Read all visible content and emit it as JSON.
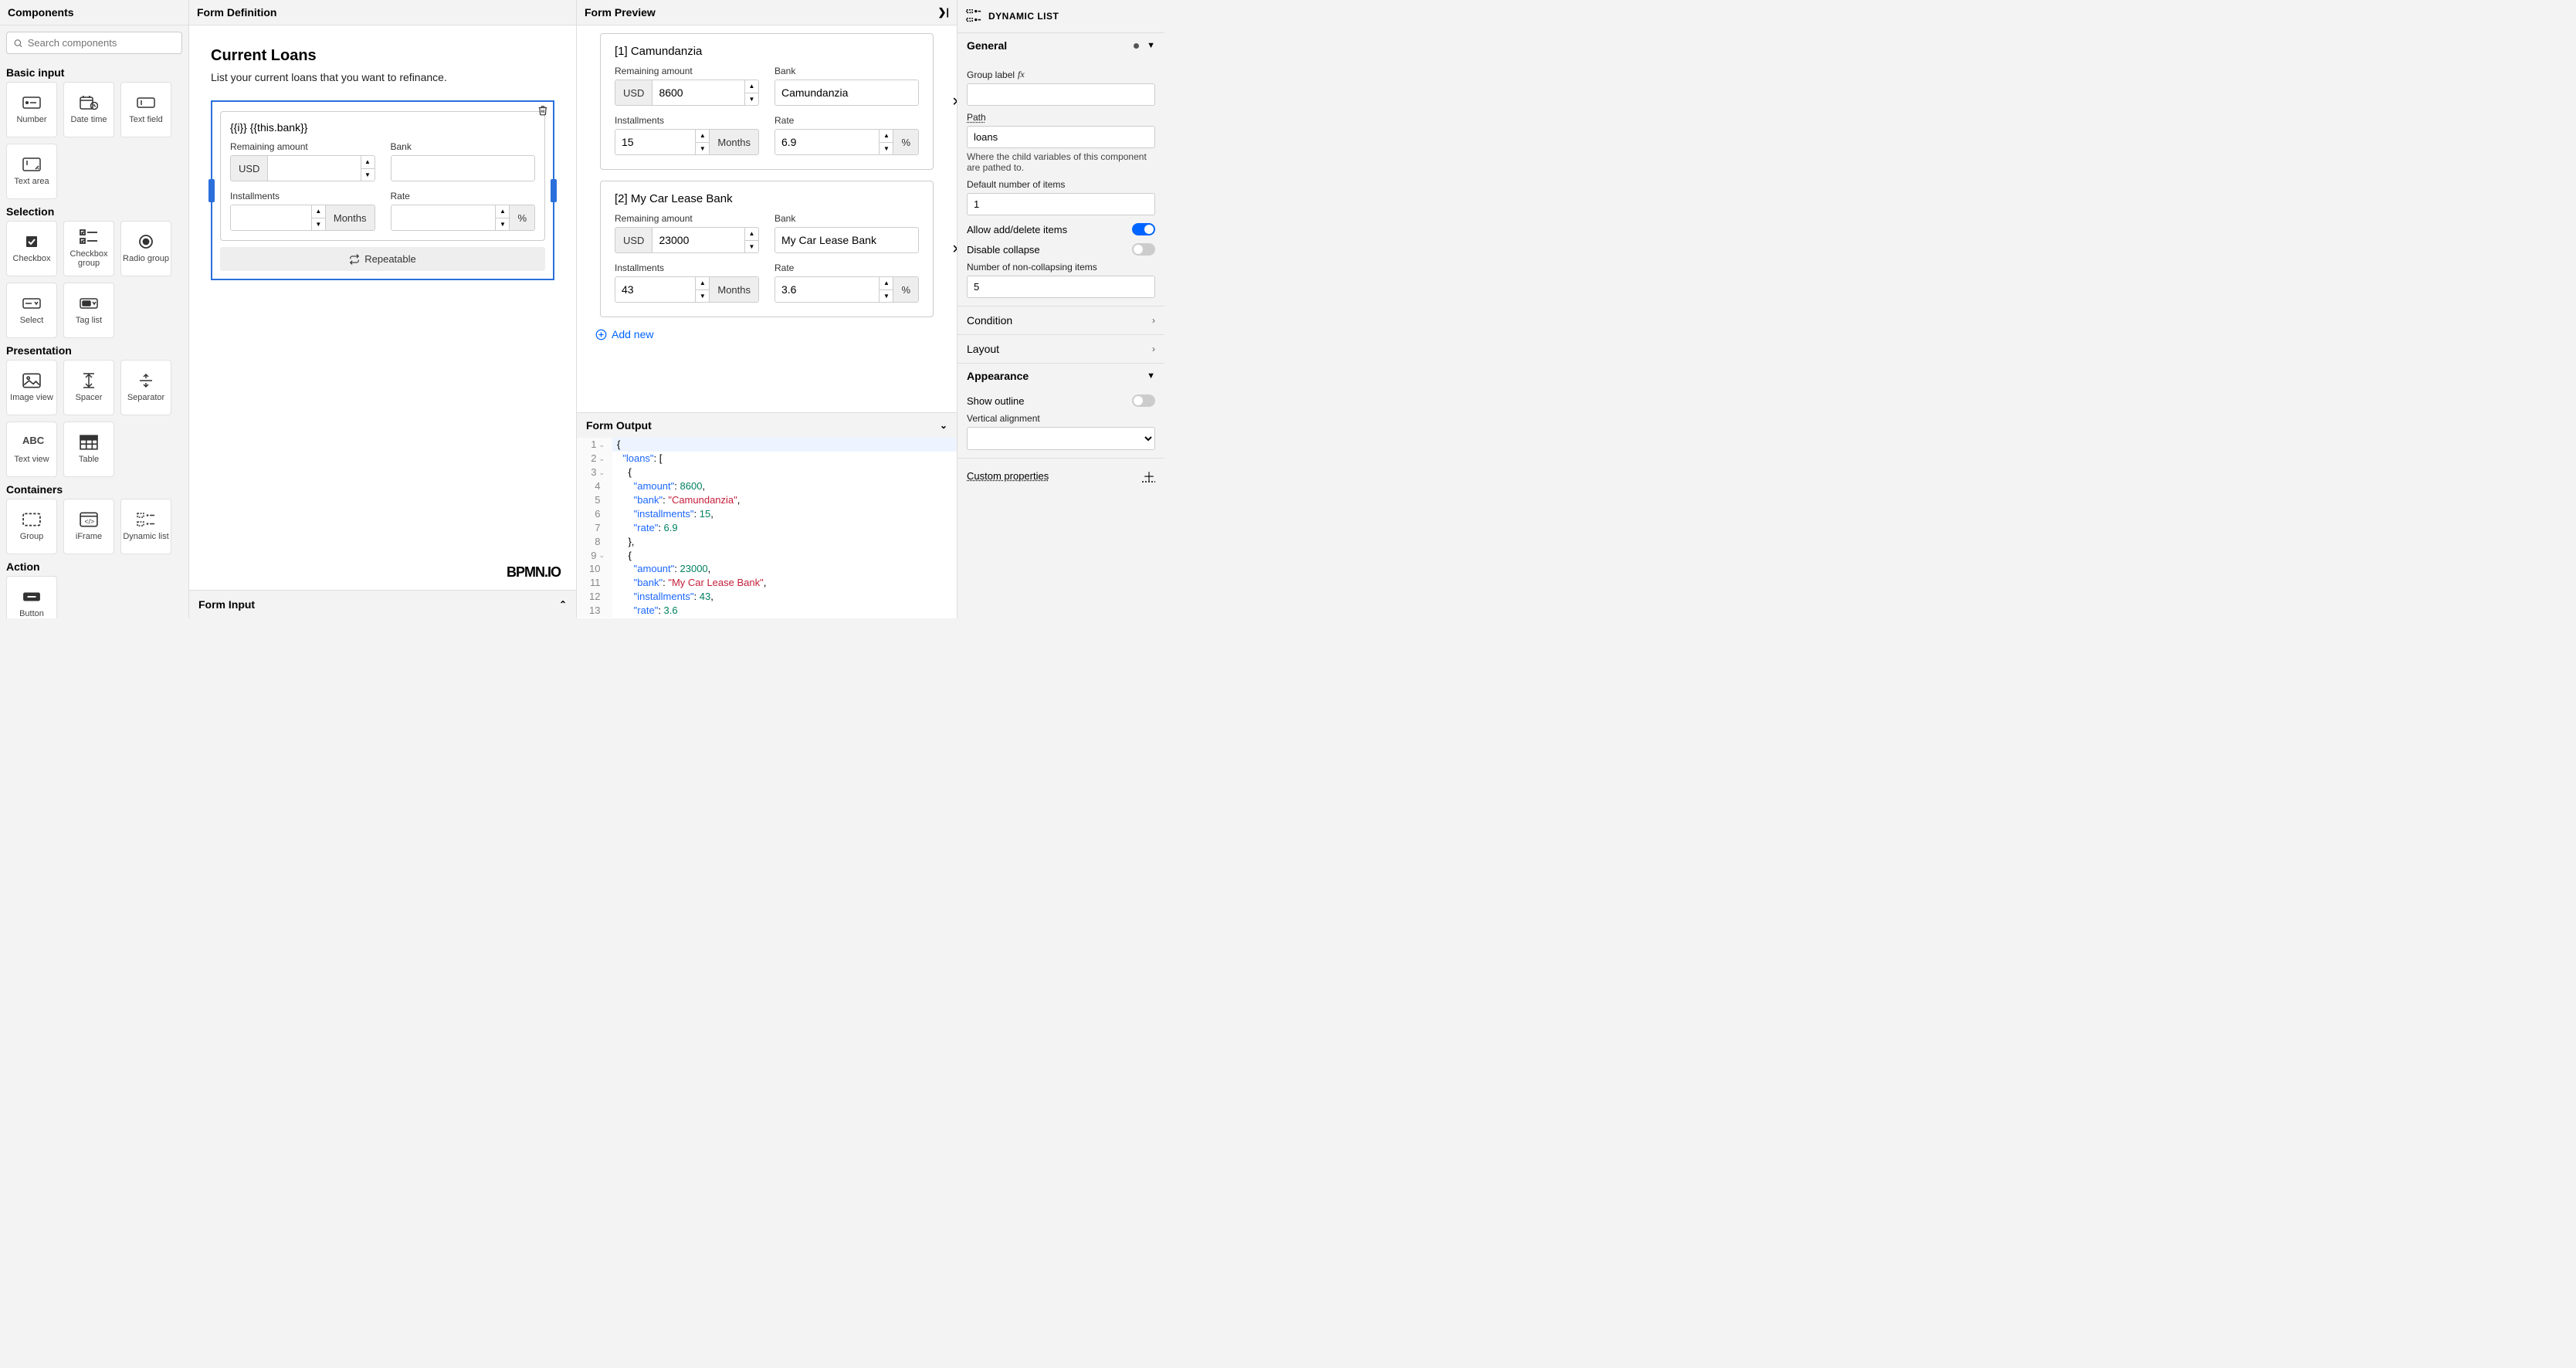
{
  "components": {
    "title": "Components",
    "search_placeholder": "Search components",
    "categories": [
      {
        "name": "Basic input",
        "items": [
          "Number",
          "Date time",
          "Text field",
          "Text area"
        ]
      },
      {
        "name": "Selection",
        "items": [
          "Checkbox",
          "Checkbox group",
          "Radio group",
          "Select",
          "Tag list"
        ]
      },
      {
        "name": "Presentation",
        "items": [
          "Image view",
          "Spacer",
          "Separator",
          "Text view",
          "Table"
        ]
      },
      {
        "name": "Containers",
        "items": [
          "Group",
          "iFrame",
          "Dynamic list"
        ]
      },
      {
        "name": "Action",
        "items": [
          "Button"
        ]
      }
    ]
  },
  "definition": {
    "title": "Form Definition",
    "form_title": "Current Loans",
    "form_sub": "List your current loans that you want to refinance.",
    "item_header": "{{i}} {{this.bank}}",
    "fields": {
      "amount_label": "Remaining amount",
      "amount_prefix": "USD",
      "bank_label": "Bank",
      "installments_label": "Installments",
      "installments_suffix": "Months",
      "rate_label": "Rate",
      "rate_suffix": "%"
    },
    "repeatable_label": "Repeatable",
    "branding": "BPMN.IO",
    "input_panel": "Form Input"
  },
  "preview": {
    "title": "Form Preview",
    "loans": [
      {
        "idx": "[1]",
        "bank": "Camundanzia",
        "amount": "8600",
        "installments": "15",
        "rate": "6.9"
      },
      {
        "idx": "[2]",
        "bank": "My Car Lease Bank",
        "amount": "23000",
        "installments": "43",
        "rate": "3.6"
      }
    ],
    "add_new": "Add new",
    "output_title": "Form Output",
    "output_lines": [
      "{",
      "  \"loans\": [",
      "    {",
      "      \"amount\": 8600,",
      "      \"bank\": \"Camundanzia\",",
      "      \"installments\": 15,",
      "      \"rate\": 6.9",
      "    },",
      "    {",
      "      \"amount\": 23000,",
      "      \"bank\": \"My Car Lease Bank\",",
      "      \"installments\": 43,",
      "      \"rate\": 3.6"
    ]
  },
  "props": {
    "type": "DYNAMIC LIST",
    "general": {
      "title": "General",
      "group_label": "Group label",
      "group_label_value": "",
      "path_label": "Path",
      "path_value": "loans",
      "path_hint": "Where the child variables of this component are pathed to.",
      "default_items_label": "Default number of items",
      "default_items_value": "1",
      "allow_add_label": "Allow add/delete items",
      "allow_add": true,
      "disable_collapse_label": "Disable collapse",
      "disable_collapse": false,
      "noncollapse_label": "Number of non-collapsing items",
      "noncollapse_value": "5"
    },
    "condition": "Condition",
    "layout": "Layout",
    "appearance": {
      "title": "Appearance",
      "show_outline_label": "Show outline",
      "show_outline": false,
      "valign_label": "Vertical alignment",
      "valign_value": ""
    },
    "custom": "Custom properties"
  }
}
